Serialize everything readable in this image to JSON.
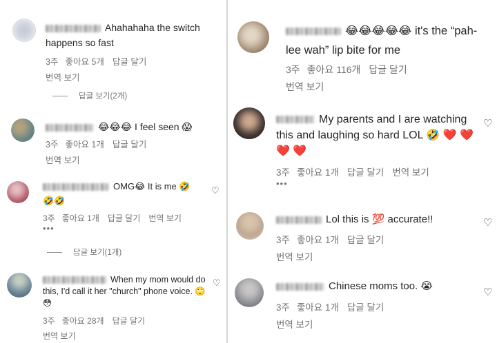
{
  "left": [
    {
      "text": "Ahahahaha the switch happens so fast",
      "time": "3주",
      "likes": "좋아요 5개",
      "reply": "답글 달기",
      "translate": "번역 보기",
      "more": "",
      "avatar": "#d9dde6",
      "name_w": 80
    },
    {
      "text": "😂😂😂 I feel seen 😱",
      "time": "3주",
      "likes": "좋아요 1개",
      "reply": "답글 달기",
      "translate": "번역 보기",
      "more": "",
      "avatar": "#7a8f8b",
      "name_w": 70
    },
    {
      "text": "OMG😂 It is me 🤣 🤣🤣",
      "time": "3주",
      "likes": "좋아요 1개",
      "reply": "답글 달기",
      "translate": "번역 보기",
      "more": "•••",
      "avatar": "#b87080",
      "name_w": 96
    },
    {
      "text": "When my mom would do this, I'd call it her \"church\" phone voice. 🙄 😳",
      "time": "3주",
      "likes": "좋아요 28개",
      "reply": "답글 달기",
      "translate": "번역 보기",
      "more": "",
      "avatar": "#5f7a8c",
      "name_w": 92
    }
  ],
  "left_replies": [
    "답글 보기(2개)",
    "답글 보기(1개)"
  ],
  "right": [
    {
      "text": "😂😂😂😂😂 it's the “pah-lee wah” lip bite for me",
      "time": "3주",
      "likes": "좋아요 116개",
      "reply": "답글 달기",
      "translate": "번역 보기",
      "more": "",
      "avatar": "#a89784",
      "name_w": 80
    },
    {
      "text": "My parents and I are watching this and laughing so hard LOL 🤣 ❤️ ❤️ ❤️ ❤️",
      "time": "3주",
      "likes": "좋아요 1개",
      "reply": "답글 달기",
      "translate": "번역 보기",
      "more": "•••",
      "avatar": "#3a3330",
      "name_w": 56
    },
    {
      "text": "Lol this is 💯 accurate!!",
      "time": "3주",
      "likes": "좋아요 1개",
      "reply": "답글 달기",
      "translate": "번역 보기",
      "more": "",
      "avatar": "#c9b9a8",
      "name_w": 66
    },
    {
      "text": "Chinese moms too. 😭",
      "time": "3주",
      "likes": "좋아요 1개",
      "reply": "답글 달기",
      "translate": "번역 보기",
      "more": "",
      "avatar": "#8e9094",
      "name_w": 70
    }
  ],
  "heart_icon": "♡"
}
